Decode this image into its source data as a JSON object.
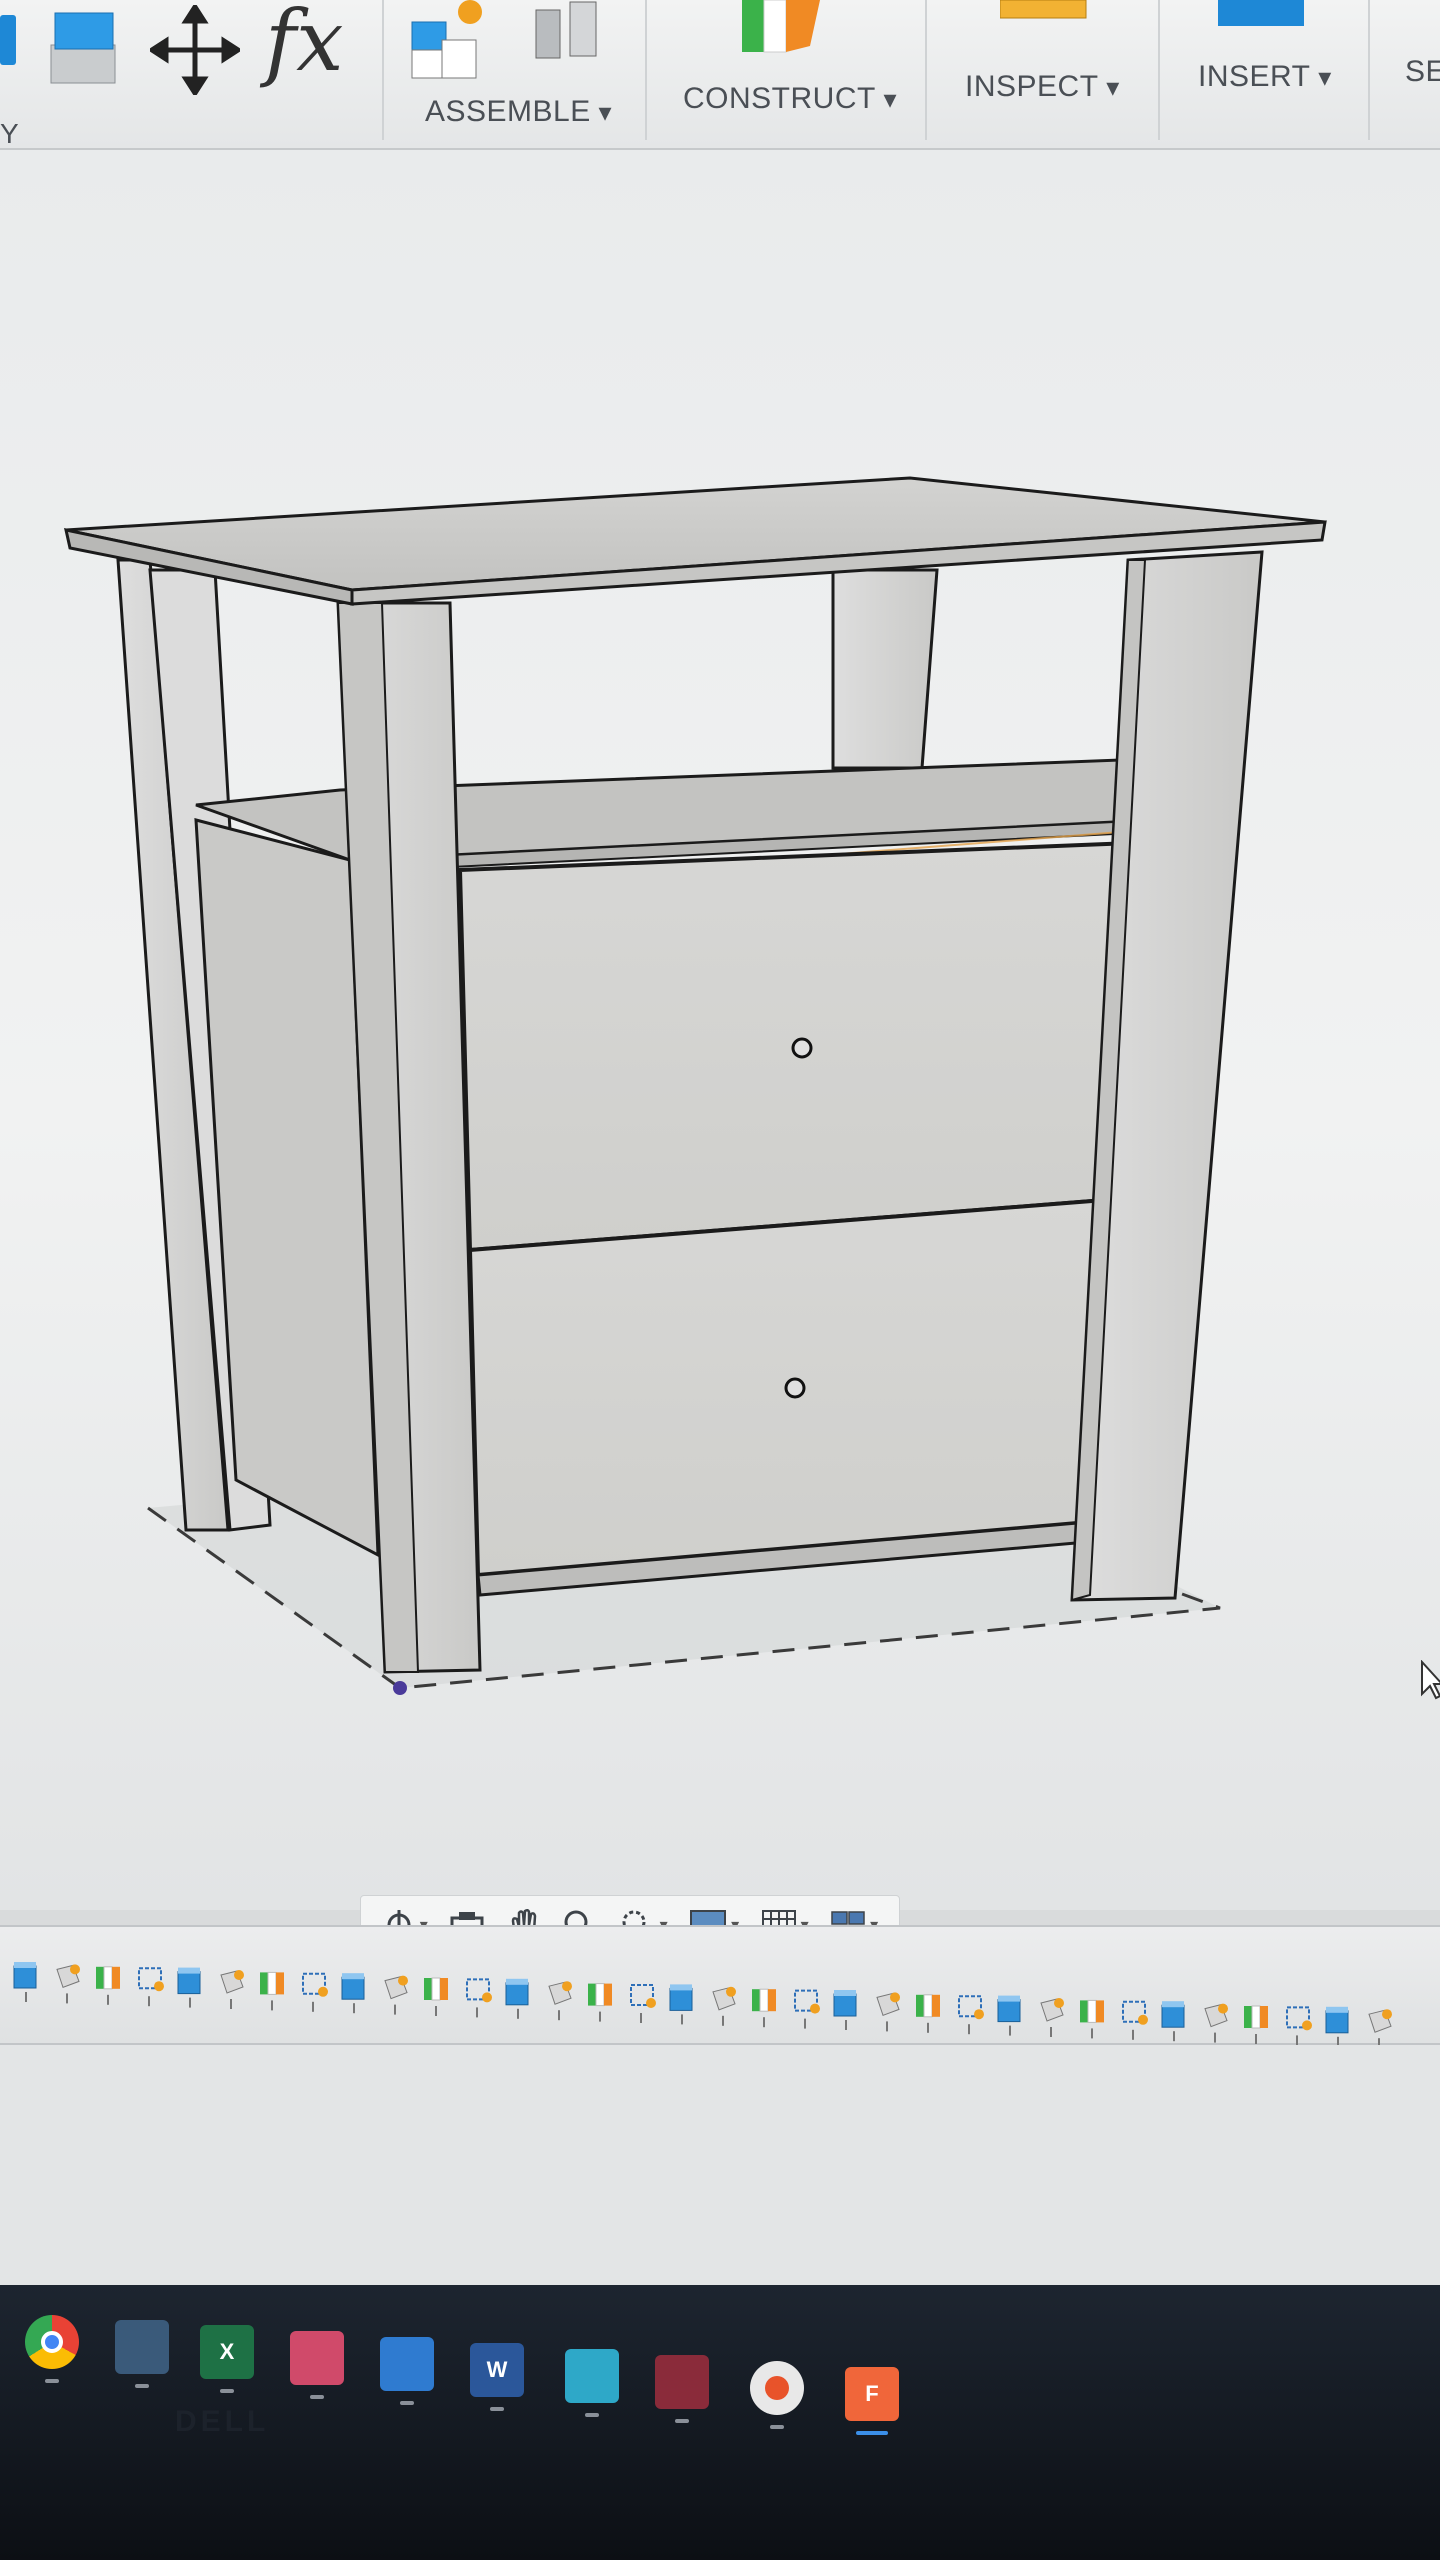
{
  "toolbar": {
    "section_fragment": "Y",
    "groups": [
      {
        "label": "ASSEMBLE"
      },
      {
        "label": "CONSTRUCT"
      },
      {
        "label": "INSPECT"
      },
      {
        "label": "INSERT"
      },
      {
        "label": "SE"
      }
    ],
    "fx_label": "fx",
    "accent_blue": "#1e88d6",
    "accent_orange": "#f08a24",
    "accent_green": "#3bb24a"
  },
  "viewport": {
    "model": "nightstand with two drawers and open top shelf",
    "edge_color": "#1b1b1b",
    "face_color": "#d8d8d6",
    "ground_dash_color": "#3a3a3a"
  },
  "navbar": {
    "items": [
      {
        "icon": "orbit-icon"
      },
      {
        "icon": "look-at-icon"
      },
      {
        "icon": "pan-hand-icon"
      },
      {
        "icon": "zoom-icon"
      },
      {
        "icon": "zoom-window-icon"
      },
      {
        "icon": "display-settings-icon"
      },
      {
        "icon": "grid-icon"
      },
      {
        "icon": "viewports-icon"
      }
    ]
  },
  "timeline": {
    "feature_icons": [
      "body-icon",
      "sketch-icon",
      "joint-icon",
      "plane-icon"
    ]
  },
  "taskbar": {
    "apps": [
      {
        "name": "chrome-icon",
        "color": "#e94235"
      },
      {
        "name": "calculator-icon",
        "color": "#3a5a7a"
      },
      {
        "name": "excel-icon",
        "color": "#1e7145",
        "glyph": "X"
      },
      {
        "name": "snipping-tool-icon",
        "color": "#d04a6a"
      },
      {
        "name": "photos-icon",
        "color": "#2f7bd0"
      },
      {
        "name": "word-icon",
        "color": "#2b579a",
        "glyph": "W"
      },
      {
        "name": "notepad-icon",
        "color": "#2ea8c8"
      },
      {
        "name": "winrar-icon",
        "color": "#8a2b3a"
      },
      {
        "name": "app-circle-icon",
        "color": "#e8e8e8"
      },
      {
        "name": "fusion360-icon",
        "color": "#f0663a",
        "glyph": "F"
      }
    ],
    "bezel_brand": "DELL"
  }
}
